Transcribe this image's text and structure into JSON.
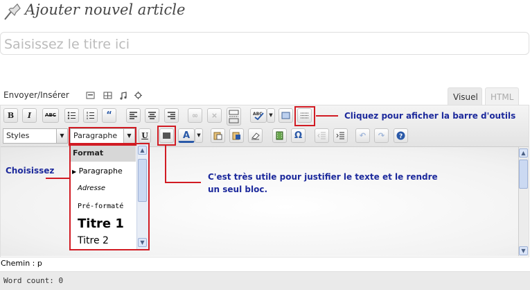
{
  "header": {
    "title": "Ajouter nouvel article",
    "icon": "pushpin-icon"
  },
  "title_input": {
    "placeholder": "Saisissez le titre ici"
  },
  "upload": {
    "label": "Envoyer/Insérer",
    "icons": [
      "image-icon",
      "video-icon",
      "music-icon",
      "media-icon"
    ]
  },
  "tabs": [
    {
      "label": "Visuel",
      "active": true
    },
    {
      "label": "HTML",
      "active": false
    }
  ],
  "toolbar": {
    "row1": [
      "B",
      "I",
      "ABC",
      "bullet-list-icon",
      "numbered-list-icon",
      "blockquote-icon",
      "align-left-icon",
      "align-center-icon",
      "align-right-icon",
      "link-icon",
      "unlink-icon",
      "more-tag-icon",
      "spellcheck-icon",
      "fullscreen-icon",
      "kitchen-sink-icon"
    ],
    "row2": {
      "styles_label": "Styles",
      "format_label": "Paragraphe",
      "underline": "U",
      "text_color": "A",
      "buttons": [
        "justify-icon",
        "text-color-icon",
        "paste-text-icon",
        "paste-word-icon",
        "remove-format-icon",
        "media-icon",
        "omega-icon",
        "outdent-icon",
        "indent-icon",
        "undo-icon",
        "redo-icon",
        "help-icon"
      ]
    }
  },
  "format_dropdown": {
    "header": "Format",
    "items": [
      "Paragraphe",
      "Adresse",
      "Pré-formaté",
      "Titre 1",
      "Titre 2"
    ],
    "selected": "Paragraphe"
  },
  "annotations": {
    "choose": "Choisissez",
    "kitchen_sink": "Cliquez pour aficher la barre d'outils",
    "justify_line1": "C'est très utile pour justifier le texte et le rendre",
    "justify_line2": "un seul bloc."
  },
  "status": {
    "path": "Chemin : p",
    "word_count": "Word count: 0"
  },
  "colors": {
    "annotation_text": "#1d2a9c",
    "highlight": "#d11b23"
  }
}
